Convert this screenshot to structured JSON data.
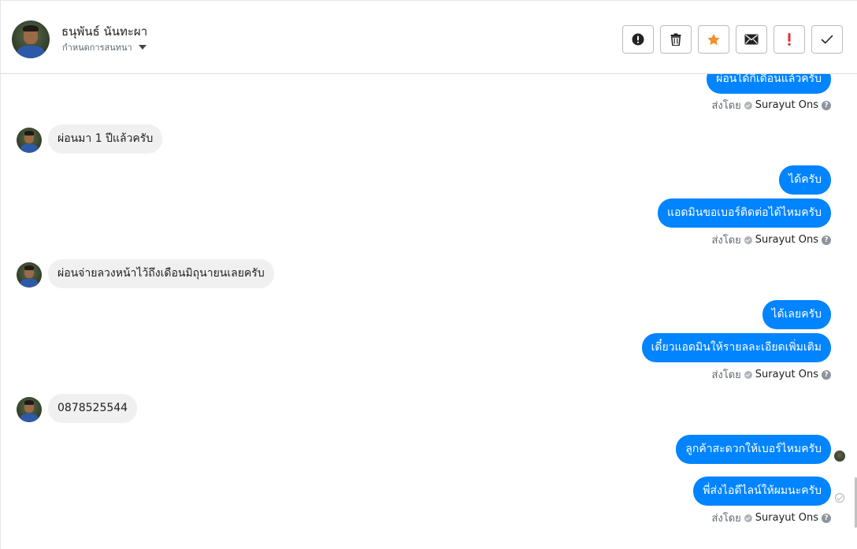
{
  "header": {
    "contact_name": "ธนุพันธ์ นันทะผา",
    "status_label": "กำหนดการสนทนา"
  },
  "toolbar": {
    "buttons": [
      {
        "name": "alert-circle",
        "icon": "exclamation-circle-icon"
      },
      {
        "name": "delete",
        "icon": "trash-icon"
      },
      {
        "name": "star",
        "icon": "star-icon",
        "color": "#f0922b"
      },
      {
        "name": "mail",
        "icon": "envelope-icon"
      },
      {
        "name": "important",
        "icon": "exclamation-icon",
        "color": "#e03131"
      },
      {
        "name": "done",
        "icon": "check-icon"
      }
    ]
  },
  "colors": {
    "outgoing_bubble": "#0084ff",
    "incoming_bubble": "#f0f0f0"
  },
  "messages": [
    {
      "dir": "out",
      "text": "ผ่อนได้กี่เดือนแล้วครับ"
    },
    {
      "dir": "meta",
      "sent_by": "ส่งโดย",
      "agent": "Surayut Ons"
    },
    {
      "dir": "in",
      "text": "ผ่อนมา 1 ปีแล้วครับ"
    },
    {
      "dir": "out",
      "text": "ได้ครับ"
    },
    {
      "dir": "out",
      "text": "แอดมินขอเบอร์ติดต่อได้ไหมครับ"
    },
    {
      "dir": "meta",
      "sent_by": "ส่งโดย",
      "agent": "Surayut Ons"
    },
    {
      "dir": "in",
      "text": "ผ่อนจ่ายลวงหน้าไว้ถึงเดือนมิถุนายนเลยครับ"
    },
    {
      "dir": "out",
      "text": "ได้เลยครับ"
    },
    {
      "dir": "out",
      "text": "เดี๋ยวแอดมินให้รายลละเอียดเพิ่มเติม"
    },
    {
      "dir": "meta",
      "sent_by": "ส่งโดย",
      "agent": "Surayut Ons"
    },
    {
      "dir": "in",
      "text": "0878525544"
    },
    {
      "dir": "out",
      "text": "ลูกค้าสะดวกให้เบอร์ไหมครับ"
    },
    {
      "dir": "out",
      "text": "พี่ส่งไอดีไลน์ให้ผมนะครับ"
    },
    {
      "dir": "meta",
      "sent_by": "ส่งโดย",
      "agent": "Surayut Ons"
    }
  ]
}
